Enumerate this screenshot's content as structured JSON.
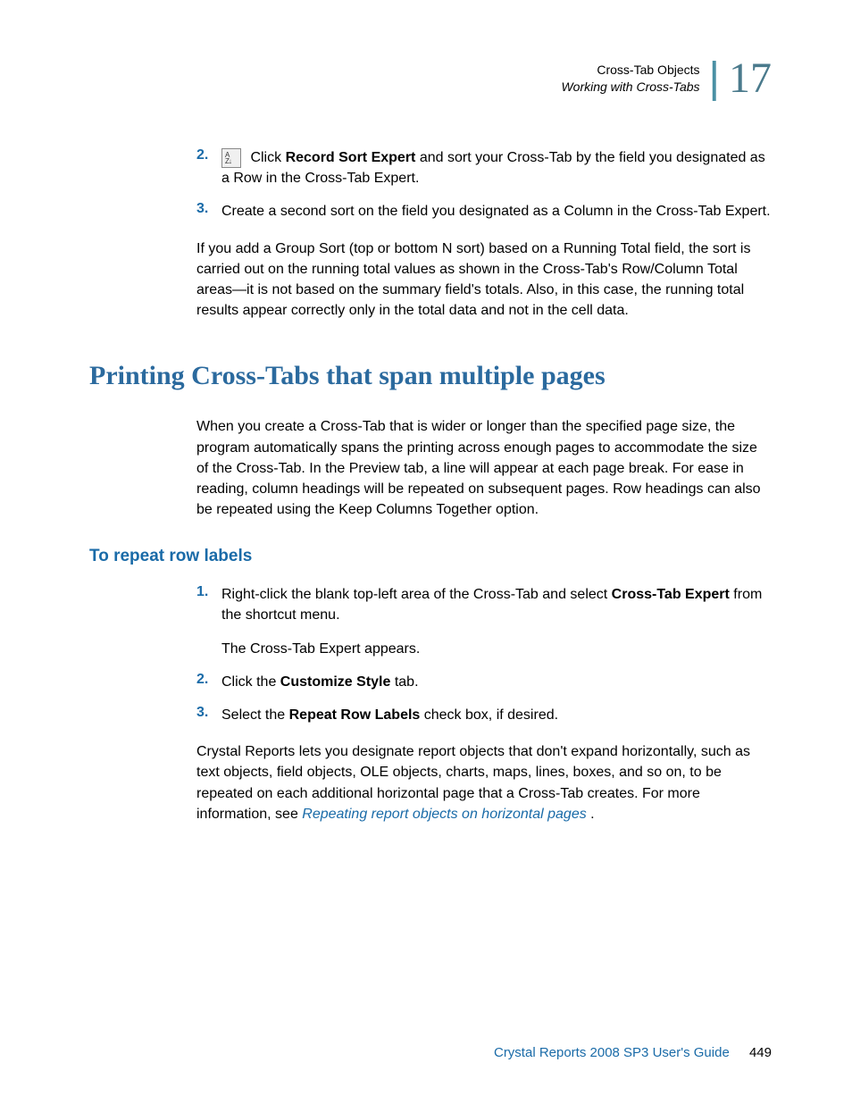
{
  "header": {
    "chapter": "Cross-Tab Objects",
    "breadcrumb": "Working with Cross-Tabs",
    "chapter_number": "17"
  },
  "steps_top": [
    {
      "num": "2.",
      "icon": "sort-az-icon",
      "pre": " Click ",
      "bold": "Record Sort Expert",
      "post": " and sort your Cross-Tab by the field you designated as a Row in the Cross-Tab Expert."
    },
    {
      "num": "3.",
      "text": "Create a second sort on the field you designated as a Column in the Cross-Tab Expert."
    }
  ],
  "para_top": "If you add a Group Sort (top or bottom N sort) based on a Running Total field, the sort is carried out on the running total values as shown in the Cross-Tab's Row/Column Total areas—it is not based on the summary field's totals. Also, in this case, the running total results appear correctly only in the total data and not in the cell data.",
  "h1": "Printing Cross-Tabs that span multiple pages",
  "para_mid": "When you create a Cross-Tab that is wider or longer than the specified page size, the program automatically spans the printing across enough pages to accommodate the size of the Cross-Tab. In the Preview tab, a line will appear at each page break. For ease in reading, column headings will be repeated on subsequent pages. Row headings can also be repeated using the Keep Columns Together option.",
  "h2": "To repeat row labels",
  "steps_bottom": {
    "s1": {
      "num": "1.",
      "pre": "Right-click the blank top-left area of the Cross-Tab and select ",
      "bold": "Cross-Tab Expert",
      "post": " from the shortcut menu.",
      "note": "The Cross-Tab Expert appears."
    },
    "s2": {
      "num": "2.",
      "pre": "Click the ",
      "bold": "Customize Style",
      "post": " tab."
    },
    "s3": {
      "num": "3.",
      "pre": "Select the ",
      "bold": "Repeat Row Labels",
      "post": " check box, if desired."
    }
  },
  "para_bottom": {
    "text": "Crystal Reports lets you designate report objects that don't expand horizontally, such as text objects, field objects, OLE objects, charts, maps, lines, boxes, and so on, to be repeated on each additional horizontal page that a Cross-Tab creates. For more information, see ",
    "link": "Repeating report objects on horizontal pages",
    "after": " ."
  },
  "footer": {
    "title": "Crystal Reports 2008 SP3 User's Guide",
    "page": "449"
  }
}
